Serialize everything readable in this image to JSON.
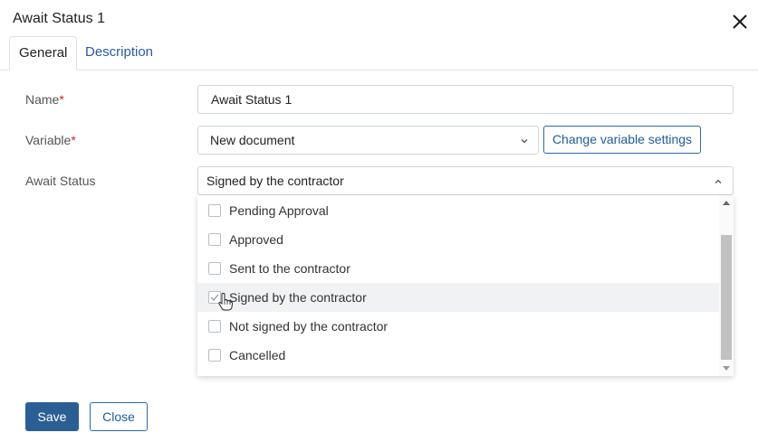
{
  "dialog": {
    "title": "Await Status 1",
    "close_icon": "close-icon"
  },
  "tabs": [
    {
      "label": "General",
      "active": true
    },
    {
      "label": "Description",
      "active": false
    }
  ],
  "form": {
    "name": {
      "label": "Name",
      "value": "Await Status 1"
    },
    "variable": {
      "label": "Variable",
      "value": "New document",
      "settings_button": "Change variable settings"
    },
    "await_status": {
      "label": "Await Status",
      "value": "Signed by the contractor"
    }
  },
  "options": [
    {
      "label": "Pending Approval",
      "checked": false
    },
    {
      "label": "Approved",
      "checked": false
    },
    {
      "label": "Sent to the contractor",
      "checked": false
    },
    {
      "label": "Signed by the contractor",
      "checked": true
    },
    {
      "label": "Not signed by the contractor",
      "checked": false
    },
    {
      "label": "Cancelled",
      "checked": false
    }
  ],
  "footer": {
    "save": "Save",
    "close": "Close"
  },
  "colors": {
    "accent": "#2a5f94",
    "link": "#2a5aa5",
    "required": "#c62828"
  }
}
